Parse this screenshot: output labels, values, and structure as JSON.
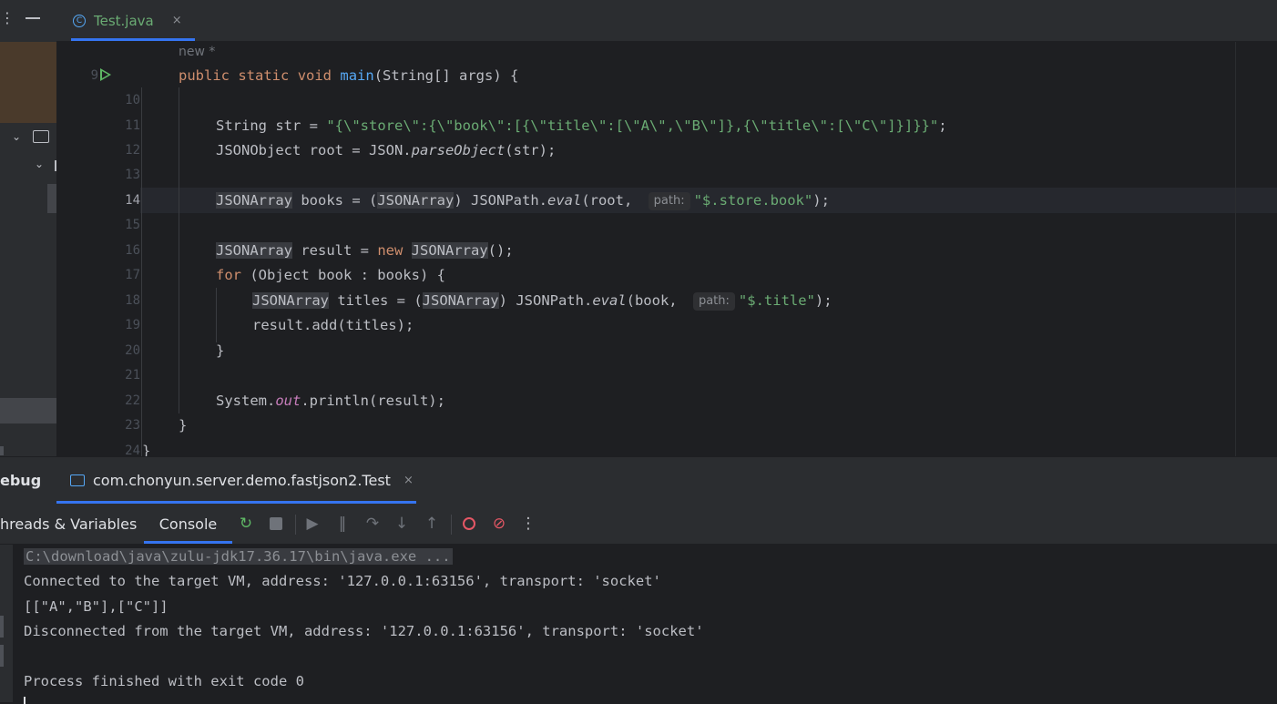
{
  "editor_tab": {
    "label": "Test.java",
    "icon": "class-c-icon",
    "close": "×"
  },
  "usage_hint": "new *",
  "gutter_lines": [
    "9",
    "10",
    "11",
    "12",
    "13",
    "14",
    "15",
    "16",
    "17",
    "18",
    "19",
    "20",
    "21",
    "22",
    "23",
    "24"
  ],
  "code": {
    "l9": {
      "kw1": "public",
      "kw2": "static",
      "kw3": "void",
      "fn": "main",
      "rest": "(String[] args) {"
    },
    "l11": {
      "a": "String str = ",
      "s": "\"{\\\"store\\\":{\\\"book\\\":[{\\\"title\\\":[\\\"A\\\",\\\"B\\\"]},{\\\"title\\\":[\\\"C\\\"]}]}}\"",
      "b": ";"
    },
    "l12": {
      "a": "JSONObject root = JSON.",
      "m": "parseObject",
      "b": "(str);"
    },
    "l14": {
      "t1": "JSONArray",
      "a": " books = (",
      "t2": "JSONArray",
      "b": ") JSONPath.",
      "m": "eval",
      "c": "(root, ",
      "hint": "path:",
      "s": "\"$.store.book\"",
      "d": ");"
    },
    "l16": {
      "t1": "JSONArray",
      "a": " result = ",
      "kw": "new",
      "sp": " ",
      "t2": "JSONArray",
      "b": "();"
    },
    "l17": {
      "kw": "for",
      "a": " (Object book : books) {"
    },
    "l18": {
      "t1": "JSONArray",
      "a": " titles = (",
      "t2": "JSONArray",
      "b": ") JSONPath.",
      "m": "eval",
      "c": "(book, ",
      "hint": "path:",
      "s": "\"$.title\"",
      "d": ");"
    },
    "l19": "result.add(titles);",
    "l20": "}",
    "l22": {
      "a": "System.",
      "f": "out",
      "b": ".println(result);"
    },
    "l23": "}",
    "l24": "}"
  },
  "debug": {
    "title": "ebug",
    "session_tab": "com.chonyun.server.demo.fastjson2.Test",
    "session_close": "×",
    "tab_threads": "hreads & Variables",
    "tab_console": "Console"
  },
  "toolbar_icons": [
    "rerun-icon",
    "stop-icon",
    "resume-icon",
    "pause-icon",
    "step-over-icon",
    "step-into-icon",
    "step-out-icon",
    "view-breakpoints-icon",
    "mute-breakpoints-icon",
    "more-icon"
  ],
  "console_lines": [
    "C:\\download\\java\\zulu-jdk17.36.17\\bin\\java.exe ...",
    "Connected to the target VM, address: '127.0.0.1:63156', transport: 'socket'",
    "[[\"A\",\"B\"],[\"C\"]]",
    "Disconnected from the target VM, address: '127.0.0.1:63156', transport: 'socket'",
    "",
    "Process finished with exit code 0"
  ],
  "colors": {
    "accent": "#3574f0",
    "keyword": "#cf8e6d",
    "string": "#6aab73",
    "function": "#56a8f5",
    "run": "#5fb865",
    "breakpoint": "#e55765"
  }
}
